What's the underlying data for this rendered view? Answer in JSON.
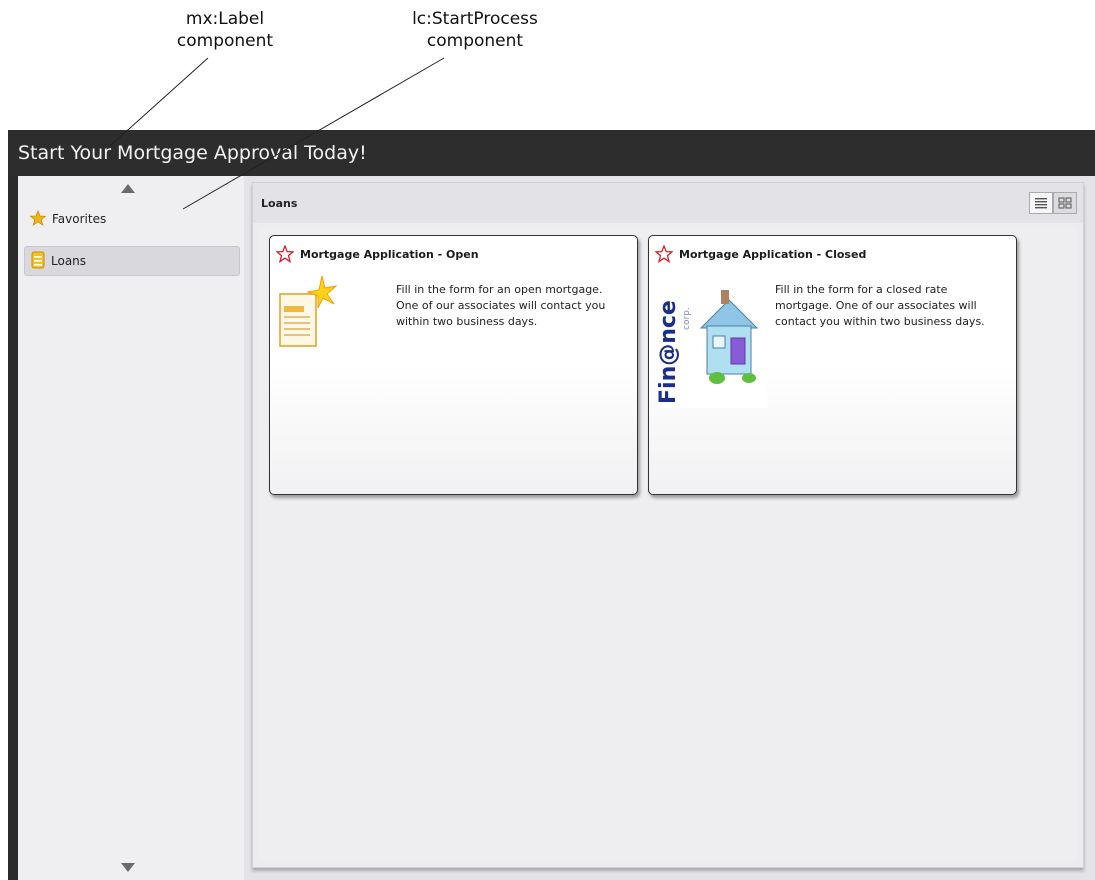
{
  "annotations": {
    "label_component": {
      "line1": "mx:Label",
      "line2": "component"
    },
    "startprocess_component": {
      "line1": "lc:StartProcess",
      "line2": "component"
    }
  },
  "app": {
    "title": "Start Your Mortgage Approval Today!"
  },
  "sidebar": {
    "items": [
      {
        "label": "Favorites",
        "icon": "star-icon",
        "selected": false
      },
      {
        "label": "Loans",
        "icon": "folder-icon",
        "selected": true
      }
    ]
  },
  "main": {
    "panel_title": "Loans",
    "view_modes": [
      {
        "icon": "list-view-icon",
        "active": false
      },
      {
        "icon": "grid-view-icon",
        "active": true
      }
    ],
    "cards": [
      {
        "title": "Mortgage Application - Open",
        "description": "Fill in the form for an open mortgage. One of our associates will contact you within two business days.",
        "icon": "form-sparkle-icon"
      },
      {
        "title": "Mortgage Application - Closed",
        "description": "Fill in the form for a closed rate mortgage. One of our associates will contact you within two business days.",
        "icon": "finance-house-logo",
        "logo_text": "Fin@nce",
        "logo_subtext": "corp."
      }
    ]
  },
  "colors": {
    "header_bg": "#2d2d2d",
    "header_text": "#f2f2f2",
    "star_outline": "#d0202a",
    "logo_blue": "#1a2e8a"
  }
}
